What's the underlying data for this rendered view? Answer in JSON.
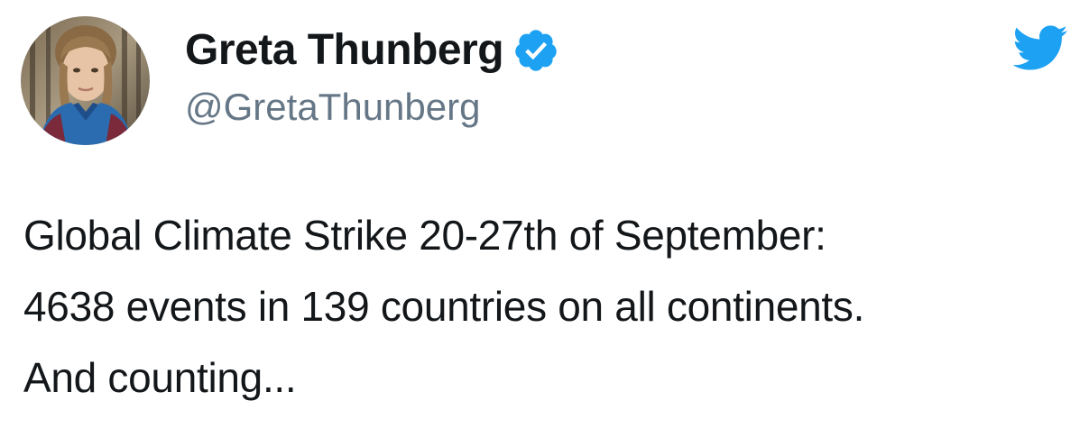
{
  "author": {
    "display_name": "Greta Thunberg",
    "handle": "@GretaThunberg",
    "verified": true,
    "avatar_icon": "profile-photo"
  },
  "brand": {
    "logo_icon": "twitter-bird-icon",
    "accent_color": "#1DA1F2",
    "handle_color": "#657786",
    "text_color": "#14171A"
  },
  "tweet": {
    "lines": [
      "Global Climate Strike 20-27th of September:",
      "4638 events in 139 countries on all continents.",
      "And counting..."
    ]
  }
}
